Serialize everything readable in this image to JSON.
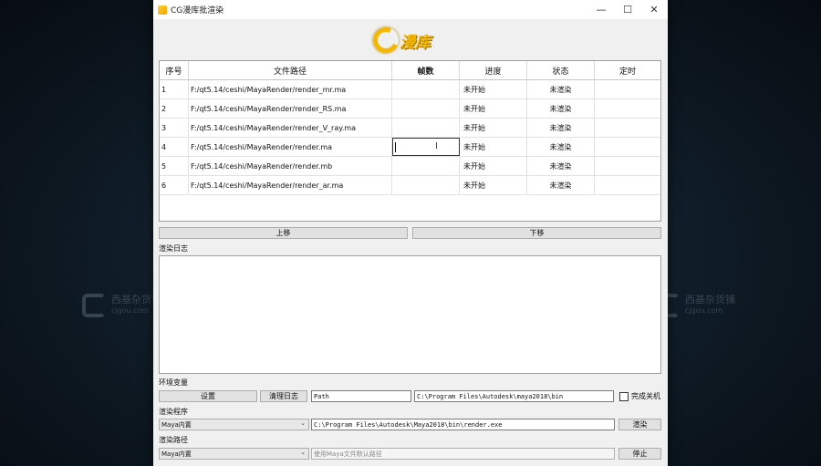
{
  "window": {
    "title": "CG漫库批渲染",
    "min": "—",
    "max": "☐",
    "close": "✕"
  },
  "logo": {
    "text": "漫库"
  },
  "watermark": {
    "name": "西基杂货铺",
    "domain": "cjgou.com"
  },
  "table": {
    "headers": [
      "序号",
      "文件路径",
      "帧数",
      "进度",
      "状态",
      "定时"
    ],
    "rows": [
      {
        "idx": "1",
        "path": "F:/qt5.14/ceshi/MayaRender/render_mr.ma",
        "frames": "",
        "progress": "未开始",
        "status": "未渲染",
        "timer": ""
      },
      {
        "idx": "2",
        "path": "F:/qt5.14/ceshi/MayaRender/render_RS.ma",
        "frames": "",
        "progress": "未开始",
        "status": "未渲染",
        "timer": ""
      },
      {
        "idx": "3",
        "path": "F:/qt5.14/ceshi/MayaRender/render_V_ray.ma",
        "frames": "",
        "progress": "未开始",
        "status": "未渲染",
        "timer": ""
      },
      {
        "idx": "4",
        "path": "F:/qt5.14/ceshi/MayaRender/render.ma",
        "frames": "",
        "progress": "未开始",
        "status": "未渲染",
        "timer": ""
      },
      {
        "idx": "5",
        "path": "F:/qt5.14/ceshi/MayaRender/render.mb",
        "frames": "",
        "progress": "未开始",
        "status": "未渲染",
        "timer": ""
      },
      {
        "idx": "6",
        "path": "F:/qt5.14/ceshi/MayaRender/render_ar.ma",
        "frames": "",
        "progress": "未开始",
        "status": "未渲染",
        "timer": ""
      }
    ]
  },
  "buttons": {
    "up": "上移",
    "down": "下移",
    "settings": "设置",
    "clear_log": "清理日志",
    "render": "渲染",
    "stop": "停止"
  },
  "labels": {
    "log": "渲染日志",
    "env": "环境变量",
    "program": "渲染程序",
    "path": "渲染路径"
  },
  "env": {
    "name": "Path",
    "value": "C:\\Program Files\\Autodesk\\maya2018\\bin",
    "shutdown_label": "完成关机",
    "shutdown_checked": false
  },
  "program": {
    "selected": "Maya内置",
    "exe": "C:\\Program Files\\Autodesk\\Maya2018\\bin\\render.exe"
  },
  "render_path": {
    "selected": "Maya内置",
    "placeholder": "使用Maya文件默认路径"
  }
}
